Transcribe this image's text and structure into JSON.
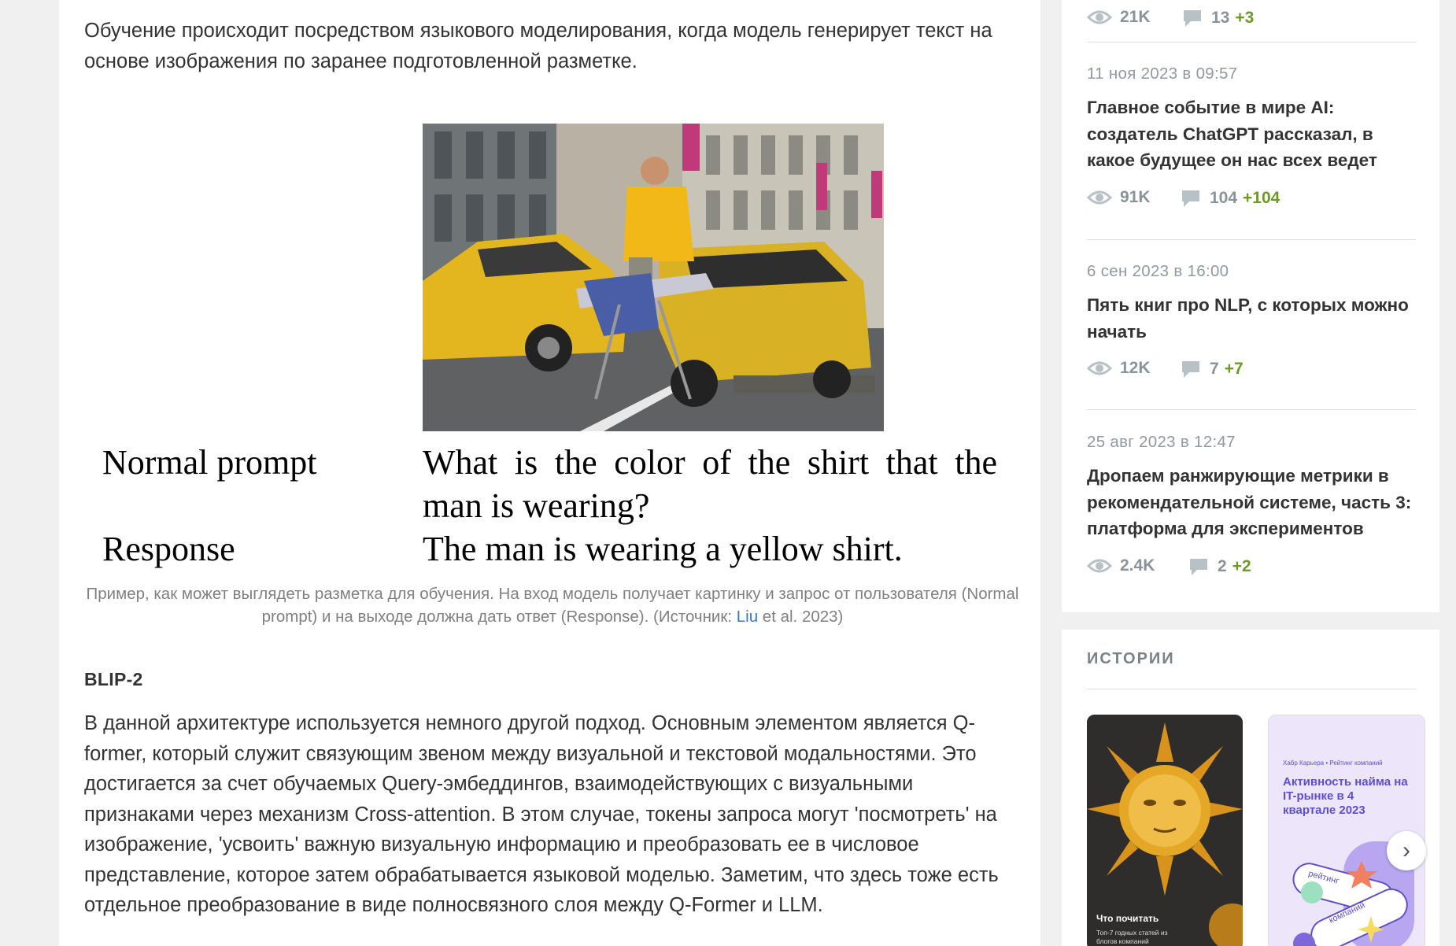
{
  "article": {
    "intro": "Обучение происходит посредством языкового моделирования, когда модель генерирует текст на основе изображения по заранее подготовленной разметке.",
    "figure": {
      "prompt_label": "Normal prompt",
      "prompt_text": "What is the color of the shirt that the man is wearing?",
      "response_label": "Response",
      "response_text": "The man is wearing a yellow shirt.",
      "caption_before": "Пример, как может выглядеть разметка для обучения. На вход модель получает картинку и запрос от пользователя (Normal prompt) и на выходе должна дать ответ (Response). (Источник: ",
      "caption_link": "Liu",
      "caption_after": " et al. 2023)"
    },
    "section_heading": "BLIP-2",
    "body": "В данной архитектуре используется немного другой подход. Основным элементом является Q-former, который служит связующим звеном между визуальной и текстовой модальностями. Это достигается за счет обучаемых Query-эмбеддингов, взаимодействующих с визуальными признаками через механизм Cross-attention. В этом случае, токены запроса могут 'посмотреть' на изображение, 'усвоить' важную визуальную информацию и преобразовать ее в числовое представление, которое затем обрабатывается языковой моделью. Заметим, что здесь тоже есть отдельное преобразование в виде полносвязного слоя между Q-Former и LLM."
  },
  "sidebar": {
    "top_partial": {
      "views": "21K",
      "comments": "13",
      "plus": "+3"
    },
    "posts": [
      {
        "date": "11 ноя 2023 в 09:57",
        "title": "Главное событие в мире AI: создатель ChatGPT рассказал, в какое будущее он нас всех ведет",
        "views": "91K",
        "comments": "104",
        "plus": "+104"
      },
      {
        "date": "6 сен 2023 в 16:00",
        "title": "Пять книг про NLP, с которых можно начать",
        "views": "12K",
        "comments": "7",
        "plus": "+7"
      },
      {
        "date": "25 авг 2023 в 12:47",
        "title": "Дропаем ранжирующие метрики в рекомендательной системе, часть 3: платформа для экспериментов",
        "views": "2.4K",
        "comments": "2",
        "plus": "+2"
      }
    ],
    "stories": {
      "title": "ИСТОРИИ",
      "card1": {
        "title": "Что почитать",
        "subtitle": "Топ-7 годных статей из блогов компаний"
      },
      "card2": {
        "header": "Хабр Карьера • Рейтинг компаний",
        "title": "Активность найма на IT-рынке в 4 квартале 2023",
        "tag1": "рейтинг",
        "tag2": "компаний"
      }
    }
  },
  "colors": {
    "accent_green": "#6b9a2a",
    "link_blue": "#3d78b5"
  }
}
